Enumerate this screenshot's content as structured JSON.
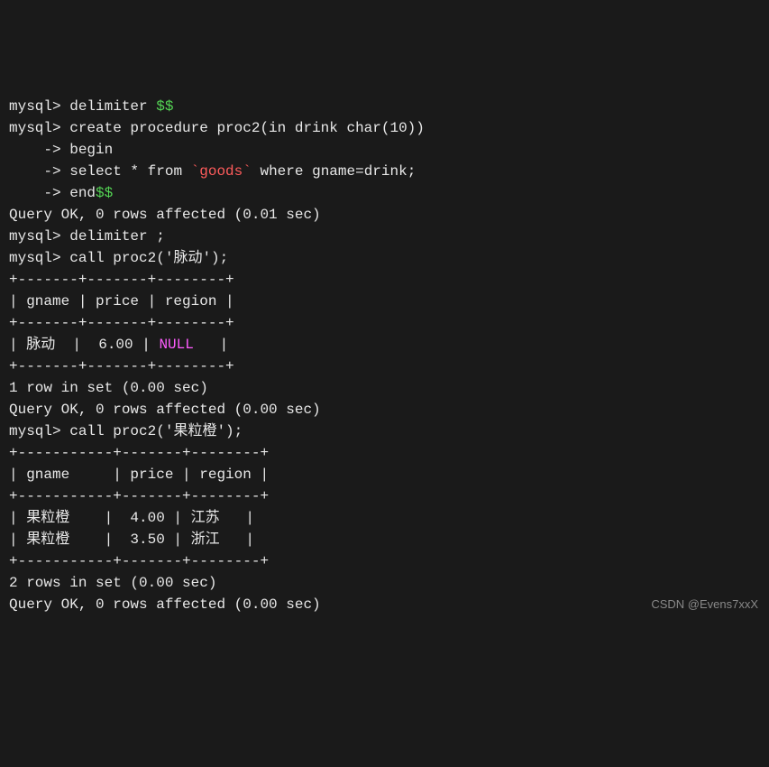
{
  "lines": {
    "l01_prompt": "mysql> ",
    "l01_cmd": "delimiter ",
    "l01_dollar": "$$",
    "l02_prompt": "mysql> ",
    "l02_cmd": "create procedure proc2(in drink char(10))",
    "l03_arrow": "    -> ",
    "l03_cmd": "begin",
    "l04_arrow": "    -> ",
    "l04_cmd_a": "select * from ",
    "l04_bt1": "`",
    "l04_table": "goods",
    "l04_bt2": "`",
    "l04_cmd_b": " where gname=drink;",
    "l05_arrow": "    -> ",
    "l05_cmd": "end",
    "l05_dollar": "$$",
    "l06": "Query OK, 0 rows affected (0.01 sec)",
    "l07": "",
    "l08_prompt": "mysql> ",
    "l08_cmd": "delimiter ;",
    "l09_prompt": "mysql> ",
    "l09_cmd": "call proc2('脉动');",
    "l10": "+-------+-------+--------+",
    "l11": "| gname | price | region |",
    "l12": "+-------+-------+--------+",
    "l13_a": "| 脉动  |  6.00 | ",
    "l13_null": "NULL",
    "l13_b": "   |",
    "l14": "+-------+-------+--------+",
    "l15": "1 row in set (0.00 sec)",
    "l16": "",
    "l17": "Query OK, 0 rows affected (0.00 sec)",
    "l18": "",
    "l19_prompt": "mysql> ",
    "l19_cmd": "call proc2('果粒橙');",
    "l20": "+-----------+-------+--------+",
    "l21": "| gname     | price | region |",
    "l22": "+-----------+-------+--------+",
    "l23": "| 果粒橙    |  4.00 | 江苏   |",
    "l24": "| 果粒橙    |  3.50 | 浙江   |",
    "l25": "+-----------+-------+--------+",
    "l26": "2 rows in set (0.00 sec)",
    "l27": "",
    "l28": "Query OK, 0 rows affected (0.00 sec)"
  },
  "watermark": "CSDN @Evens7xxX",
  "chart_data": {
    "type": "table",
    "tables": [
      {
        "query": "call proc2('脉动')",
        "columns": [
          "gname",
          "price",
          "region"
        ],
        "rows": [
          {
            "gname": "脉动",
            "price": "6.00",
            "region": "NULL"
          }
        ],
        "summary": "1 row in set (0.00 sec)"
      },
      {
        "query": "call proc2('果粒橙')",
        "columns": [
          "gname",
          "price",
          "region"
        ],
        "rows": [
          {
            "gname": "果粒橙",
            "price": "4.00",
            "region": "江苏"
          },
          {
            "gname": "果粒橙",
            "price": "3.50",
            "region": "浙江"
          }
        ],
        "summary": "2 rows in set (0.00 sec)"
      }
    ]
  }
}
